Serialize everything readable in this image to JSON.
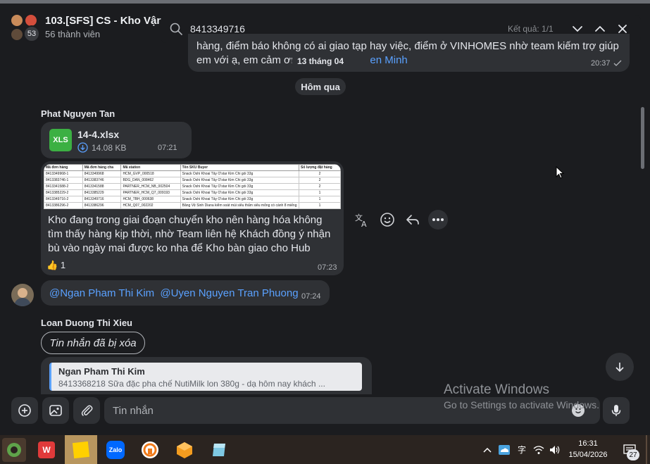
{
  "header": {
    "group_name": "103.[SFS] CS - Kho Vận",
    "member_count": "56 thành viên",
    "avatar_badge": "53"
  },
  "search": {
    "query": "8413349716",
    "result_count": "Kết quả: 1/1"
  },
  "messages": {
    "top_message": {
      "line1": "hàng, điểm báo không có ai giao tạp hay việc, điểm ở VINHOMES nhờ team kiếm trợ giúp",
      "line2_start": "em với ạ, em cảm ơn",
      "line2_mention": "en Minh",
      "time": "20:37"
    },
    "date_pill_old": "13 tháng 04",
    "date_pill_yesterday": "Hôm qua",
    "sender_1": "Phat Nguyen Tan",
    "file": {
      "type_label": "XLS",
      "name": "14-4.xlsx",
      "size": "14.08 KB",
      "time": "07:21"
    },
    "image_table": {
      "headers": [
        "Mã đơn hàng",
        "Mã đơn hàng cha",
        "Mã station",
        "Tên SKU Buyer",
        "Số lượng đặt hàng"
      ],
      "rows": [
        [
          "8413349968-1",
          "8413349968",
          "HCM_GVP_000518",
          "Snack Oshi Khoai Tây O'star Kim Chi gói 33g",
          "2"
        ],
        [
          "8413383746-1",
          "8413383746",
          "BDG_DAN_008462",
          "Snack Oshi Khoai Tây O'star Kim Chi gói 33g",
          "2"
        ],
        [
          "8413341588-2",
          "8413341588",
          "PARTNER_HCM_NB_002504",
          "Snack Oshi Khoai Tây O'star Kim Chi gói 33g",
          "2"
        ],
        [
          "8413385229-2",
          "8413385229",
          "PARTNER_HCM_Q7_009193",
          "Snack Oshi Khoai Tây O'star Kim Chi gói 33g",
          "1"
        ],
        [
          "8413349716-2",
          "8413349716",
          "HCM_TBH_000638",
          "Snack Oshi Khoai Tây O'star Kim Chi gói 33g",
          "1"
        ],
        [
          "8413386296-2",
          "8413386296",
          "HCM_Q07_002202",
          "Băng Vệ Sinh Diana kiểm soát mùi siêu thấm siêu mỏng có cánh 8 miếng",
          "1"
        ]
      ]
    },
    "image_message": {
      "text": "Kho đang trong giai đoạn chuyển kho nên hàng hóa không tìm thấy hàng kịp thời, nhờ Team liên hệ Khách đồng ý nhận bù vào ngày mai được ko nha để Kho bàn giao cho Hub",
      "reaction_emoji": "👍",
      "reaction_count": "1",
      "time": "07:23"
    },
    "mention_message": {
      "mention1": "@Ngan Pham Thi Kim",
      "mention2": "@Uyen Nguyen Tran Phuong",
      "time": "07:24"
    },
    "sender_2": "Loan Duong Thi Xieu",
    "deleted_text": "Tin nhắn đã bị xóa",
    "quote": {
      "author": "Ngan Pham Thi Kim",
      "text": "8413368218 Sữa đặc pha chế NutiMilk lon 380g - dạ hôm nay khách ..."
    }
  },
  "input": {
    "placeholder": "Tin nhắn"
  },
  "watermark": {
    "title": "Activate Windows",
    "subtitle": "Go to Settings to activate Windows."
  },
  "taskbar": {
    "time": "16:31",
    "date": "15/04/2026",
    "notification_count": "27",
    "lang": "字"
  },
  "colors": {
    "bubble": "#2f3135",
    "background": "#1b1c1f",
    "mention": "#5aa1ff",
    "xls_green": "#3cb043"
  }
}
